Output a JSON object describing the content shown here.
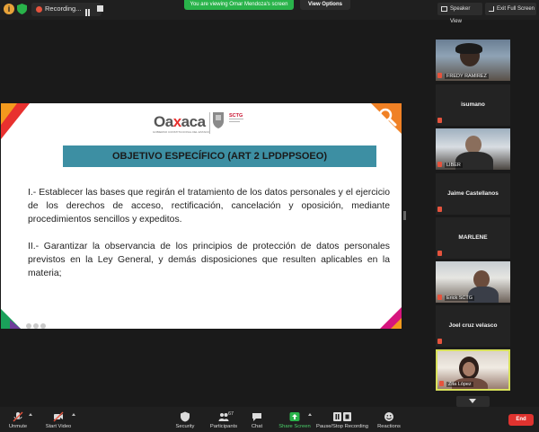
{
  "topbar": {
    "info_icon": "info-icon",
    "shield_icon": "shield-icon",
    "recording_label": "Recording...",
    "viewing_banner": "You are viewing Omar Mendoza's screen",
    "view_options": "View Options",
    "speaker_view": "Speaker View",
    "exit_full_screen": "Exit Full Screen"
  },
  "slide": {
    "logo_word_left": "Oa",
    "logo_word_mid": "x",
    "logo_word_right": "aca",
    "logo_subtitle": "GOBIERNO CONSTITUCIONAL DEL ESTADO",
    "logo_sctg": "SCTG",
    "objective_title": "OBJETIVO ESPECÍFICO (ART 2 LPDPPSOEO)",
    "paragraph_1": "I.- Establecer las bases que regirán el tratamiento de los datos personales y el ejercicio de los derechos de acceso, rectificación, cancelación y oposición, mediante procedimientos sencillos y expeditos.",
    "paragraph_2": "II.- Garantizar la observancia de los principios de protección de datos personales previstos en la Ley General, y demás disposiciones que resulten aplicables en la materia;"
  },
  "participants": [
    {
      "name": "FREDY RAMIREZ",
      "video": true
    },
    {
      "name": "isumano",
      "video": false
    },
    {
      "name": "LIBER",
      "video": true
    },
    {
      "name": "Jaime Castellanos",
      "video": false
    },
    {
      "name": "MARLENE",
      "video": false
    },
    {
      "name": "Erick SCTG",
      "video": true
    },
    {
      "name": "Joel cruz velasco",
      "video": false
    },
    {
      "name": "Zita López",
      "video": true,
      "active_speaker": true
    }
  ],
  "toolbar": {
    "unmute": "Unmute",
    "start_video": "Start Video",
    "security": "Security",
    "participants": "Participants",
    "participants_count": "67",
    "chat": "Chat",
    "share_screen": "Share Screen",
    "pause_stop_recording": "Pause/Stop Recording",
    "reactions": "Reactions",
    "end": "End"
  },
  "colors": {
    "accent_green": "#29b34a",
    "banner_teal": "#3d8fa3",
    "end_red": "#e0332f",
    "active_speaker_border": "#d8e15a"
  }
}
